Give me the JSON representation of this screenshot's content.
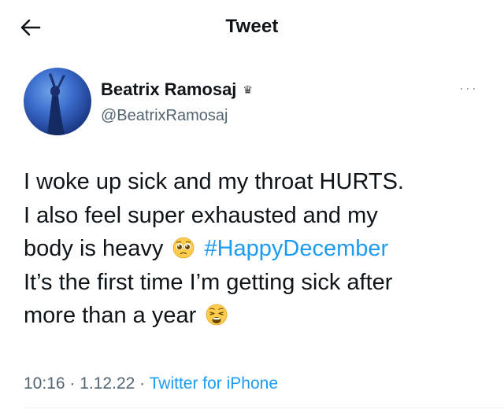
{
  "header": {
    "title": "Tweet",
    "back_icon": "arrow-left-icon"
  },
  "author": {
    "display_name": "Beatrix Ramosaj",
    "handle": "@BeatrixRamosaj",
    "badge_icon": "crown-icon",
    "avatar": "avatar-photo"
  },
  "more_icon": "more-options-icon",
  "tweet": {
    "line1": "I woke up sick and my throat HURTS.",
    "line2": "I also feel super exhausted and my",
    "line3_prefix": "body is heavy",
    "emoji1": "pleading-face-emoji",
    "hashtag": "#HappyDecember",
    "line4": "It’s the first time I’m getting sick after",
    "line5_prefix": "more than a year",
    "emoji2": "weary-face-emoji"
  },
  "meta": {
    "time": "10:16",
    "sep1": " · ",
    "date": "1.12.22",
    "sep2": " · ",
    "source": "Twitter for iPhone"
  },
  "colors": {
    "link": "#1d9bf0",
    "secondary_text": "#536471",
    "text": "#0f1419"
  }
}
